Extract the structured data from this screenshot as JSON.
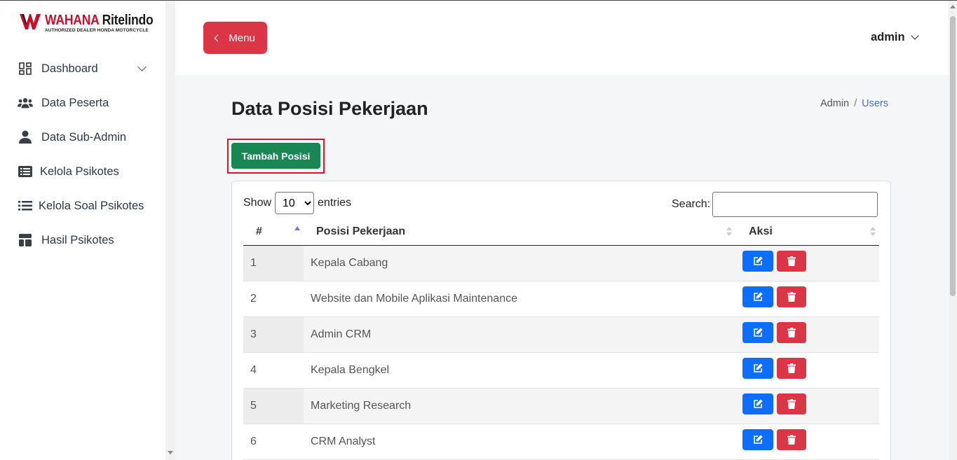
{
  "brand": {
    "name_part1": "WAHANA",
    "name_part2": "Ritelindo",
    "subtitle": "AUTHORIZED DEALER HONDA MOTORCYCLE"
  },
  "sidebar": {
    "items": [
      {
        "label": "Dashboard",
        "icon": "dashboard-grid-icon"
      },
      {
        "label": "Data Peserta",
        "icon": "users-group-icon"
      },
      {
        "label": "Data Sub-Admin",
        "icon": "user-icon"
      },
      {
        "label": "Kelola Psikotes",
        "icon": "list-alt-icon"
      },
      {
        "label": "Kelola Soal Psikotes",
        "icon": "list-icon"
      },
      {
        "label": "Hasil Psikotes",
        "icon": "layout-icon"
      }
    ]
  },
  "header": {
    "menu_label": "Menu",
    "user_label": "admin"
  },
  "page": {
    "title": "Data Posisi Pekerjaan",
    "breadcrumb": [
      "Admin",
      "Users"
    ],
    "add_button": "Tambah Posisi"
  },
  "table": {
    "show_label": "Show",
    "entries_value": "10",
    "entries_label": "entries",
    "search_label": "Search:",
    "search_value": "",
    "columns": [
      "#",
      "Posisi Pekerjaan",
      "Aksi"
    ],
    "rows": [
      {
        "num": "1",
        "posisi": "Kepala Cabang"
      },
      {
        "num": "2",
        "posisi": "Website dan Mobile Aplikasi Maintenance"
      },
      {
        "num": "3",
        "posisi": "Admin CRM"
      },
      {
        "num": "4",
        "posisi": "Kepala Bengkel"
      },
      {
        "num": "5",
        "posisi": "Marketing Research"
      },
      {
        "num": "6",
        "posisi": "CRM Analyst"
      }
    ]
  },
  "colors": {
    "danger": "#dc3545",
    "success": "#198754",
    "primary": "#0d6efd",
    "breadcrumb_active": "#4a6fd8"
  }
}
